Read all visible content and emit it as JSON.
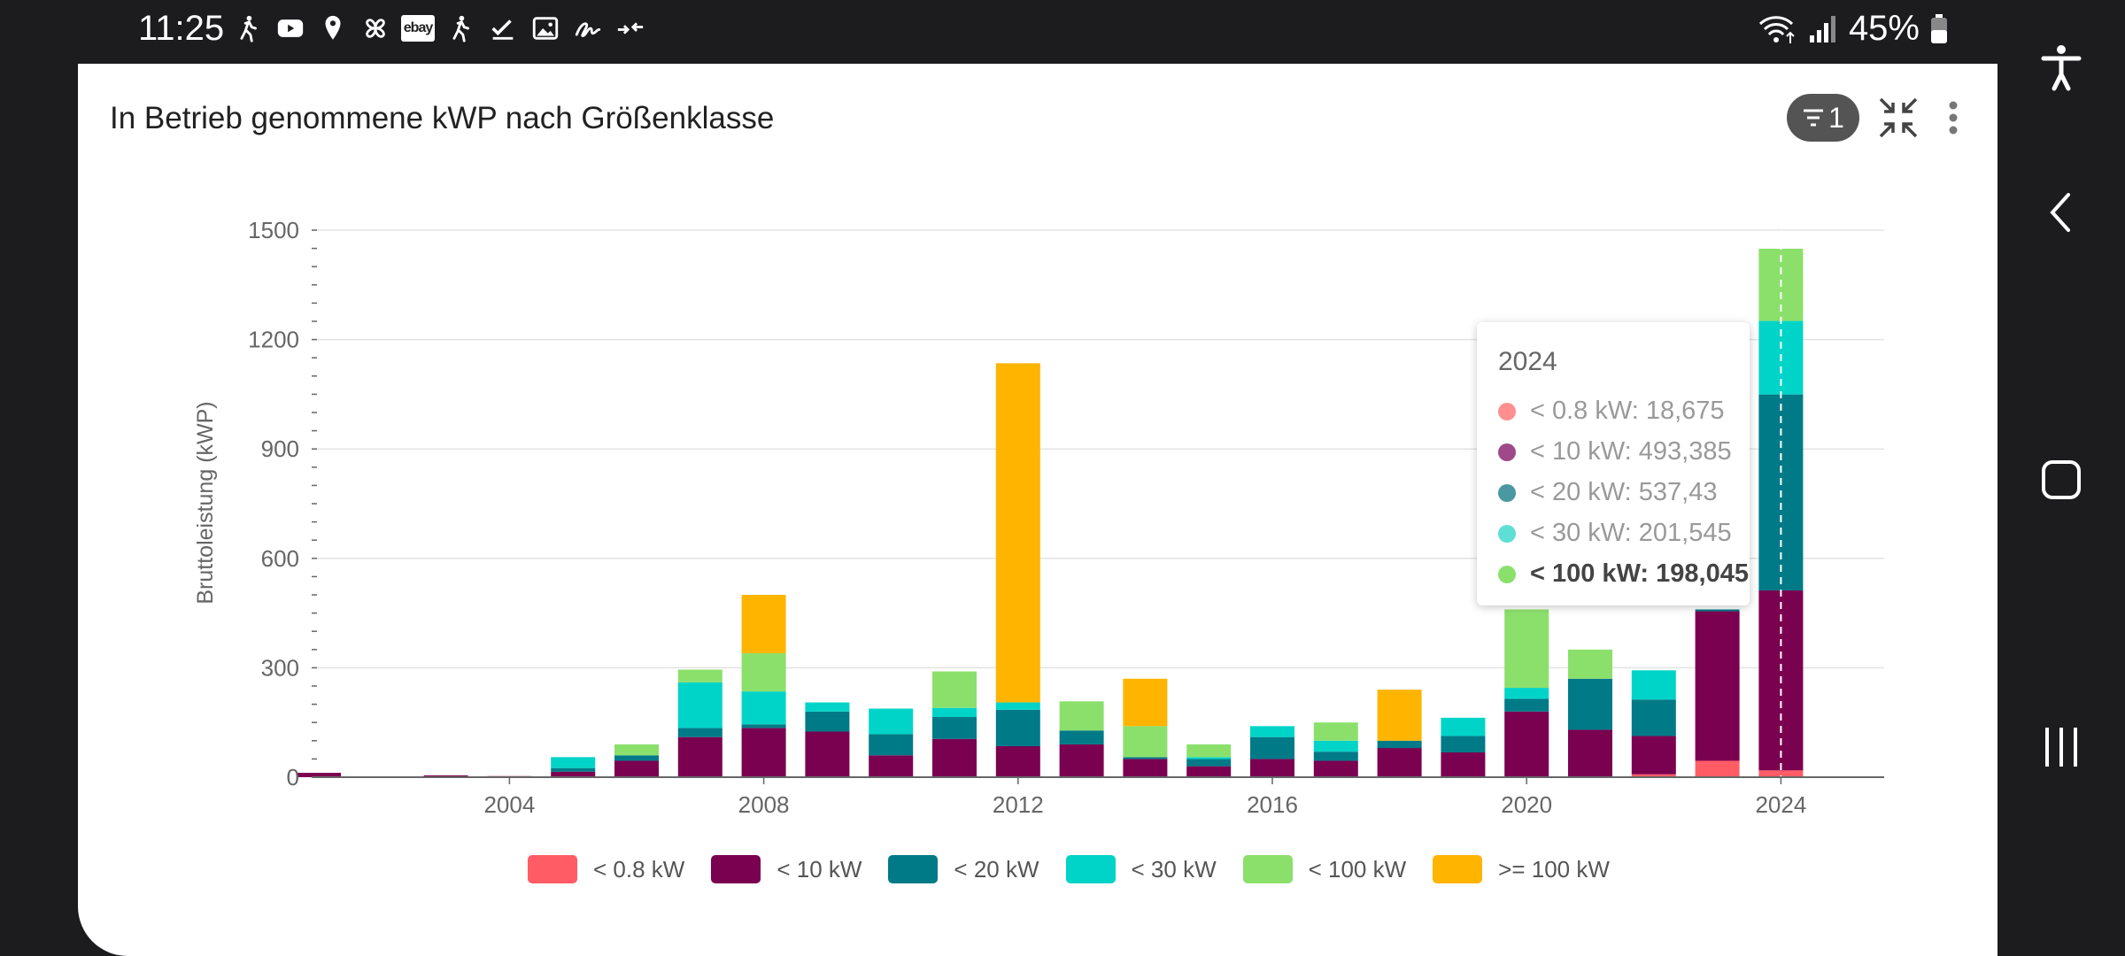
{
  "status": {
    "time": "11:25",
    "battery": "45%",
    "icons": [
      "walk-icon",
      "youtube-icon",
      "location-icon",
      "pinwheel-icon",
      "ebay-icon",
      "walk-icon",
      "check-icon",
      "image-icon",
      "signature-icon",
      "transfer-icon"
    ],
    "ebay_text": "ebay"
  },
  "panel": {
    "title": "In Betrieb genommene kWP nach Größenklasse",
    "filter_count": "1"
  },
  "colors": {
    "lt08": "#ff5c66",
    "lt10": "#7a0050",
    "lt20": "#007a87",
    "lt30": "#00d4c8",
    "lt100": "#8be06c",
    "ge100": "#ffb400"
  },
  "chart_data": {
    "type": "bar",
    "stacked": true,
    "ylabel": "Bruttoleistung (kWP)",
    "ylim": [
      0,
      1500
    ],
    "yticks": [
      0,
      300,
      600,
      900,
      1200,
      1500
    ],
    "xticks": [
      2004,
      2008,
      2012,
      2016,
      2020,
      2024
    ],
    "categories": [
      2001,
      2002,
      2003,
      2004,
      2005,
      2006,
      2007,
      2008,
      2009,
      2010,
      2011,
      2012,
      2013,
      2014,
      2015,
      2016,
      2017,
      2018,
      2019,
      2020,
      2021,
      2022,
      2023,
      2024
    ],
    "series": [
      {
        "name": "< 0.8 kW",
        "values": [
          0,
          0,
          0,
          0,
          0,
          0,
          0,
          0,
          0,
          0,
          0,
          0,
          0,
          0,
          0,
          0,
          0,
          0,
          0,
          0,
          0,
          8,
          45,
          18.675
        ]
      },
      {
        "name": "< 10 kW",
        "values": [
          12,
          0,
          5,
          3,
          15,
          45,
          110,
          135,
          125,
          60,
          105,
          85,
          90,
          50,
          30,
          50,
          45,
          80,
          68,
          180,
          130,
          105,
          410,
          493.385
        ]
      },
      {
        "name": "< 20 kW",
        "values": [
          0,
          0,
          0,
          0,
          10,
          15,
          25,
          10,
          55,
          58,
          60,
          100,
          38,
          5,
          20,
          60,
          25,
          20,
          45,
          35,
          140,
          100,
          5,
          537.43
        ]
      },
      {
        "name": "< 30 kW",
        "values": [
          0,
          0,
          0,
          0,
          30,
          0,
          125,
          90,
          25,
          70,
          25,
          20,
          0,
          0,
          5,
          30,
          30,
          0,
          50,
          30,
          0,
          80,
          0,
          201.545
        ]
      },
      {
        "name": "< 100 kW",
        "values": [
          0,
          0,
          0,
          0,
          0,
          30,
          35,
          105,
          0,
          0,
          100,
          0,
          80,
          85,
          35,
          0,
          50,
          0,
          0,
          215,
          80,
          0,
          0,
          198.045
        ]
      },
      {
        "name": ">= 100 kW",
        "values": [
          0,
          0,
          0,
          0,
          0,
          0,
          0,
          160,
          0,
          0,
          0,
          930,
          0,
          130,
          0,
          0,
          0,
          140,
          0,
          0,
          0,
          0,
          0,
          0
        ]
      }
    ],
    "highlight_category": 2024
  },
  "tooltip": {
    "title": "2024",
    "rows": [
      {
        "text": "< 0.8 kW: 18,675",
        "color": "#ff8f8f"
      },
      {
        "text": "< 10 kW: 493,385",
        "color": "#9e4a8a"
      },
      {
        "text": "< 20 kW: 537,43",
        "color": "#4a98a1"
      },
      {
        "text": "< 30 kW: 201,545",
        "color": "#5ddfd6"
      },
      {
        "text": "< 100 kW: 198,045",
        "color": "#8be06c"
      }
    ]
  },
  "legend": [
    {
      "label": "< 0.8 kW",
      "color": "#ff5c66"
    },
    {
      "label": "< 10 kW",
      "color": "#7a0050"
    },
    {
      "label": "< 20 kW",
      "color": "#007a87"
    },
    {
      "label": "< 30 kW",
      "color": "#00d4c8"
    },
    {
      "label": "< 100 kW",
      "color": "#8be06c"
    },
    {
      "label": ">= 100 kW",
      "color": "#ffb400"
    }
  ],
  "nav": {
    "icons": [
      "accessibility-icon",
      "back-icon",
      "home-icon",
      "recents-icon"
    ]
  }
}
